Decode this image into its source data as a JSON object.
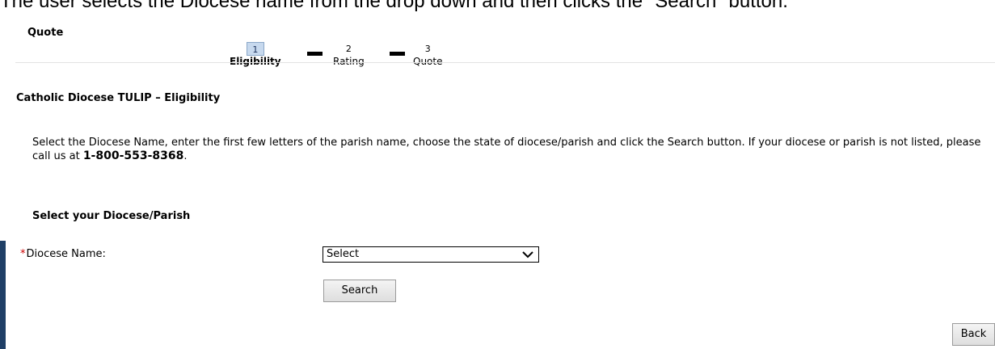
{
  "caption": "The user selects the Diocese name from the drop down and then clicks the \"Search\" button.",
  "page_title": "Quote",
  "steps": [
    {
      "number": "1",
      "label": "Eligibility",
      "active": true
    },
    {
      "number": "2",
      "label": "Rating",
      "active": false
    },
    {
      "number": "3",
      "label": "Quote",
      "active": false
    }
  ],
  "section_title": "Catholic Diocese TULIP – Eligibility",
  "instructions": {
    "text": "Select the Diocese Name, enter the first few letters of the parish name, choose the state of diocese/parish and click the Search button. If your diocese or parish is not listed, please call us at ",
    "phone": "1-800-553-8368",
    "end": "."
  },
  "subsection_title": "Select your Diocese/Parish",
  "diocese_field": {
    "required_marker": "*",
    "label": "Diocese Name:",
    "selected_value": "Select",
    "chevron_icon": "chevron-down-icon"
  },
  "buttons": {
    "search_label": "Search",
    "back_label": "Back"
  },
  "colors": {
    "active_step_bg": "#c7d9ee",
    "required_marker": "#cc0000",
    "left_bar": "#1f3f66"
  }
}
